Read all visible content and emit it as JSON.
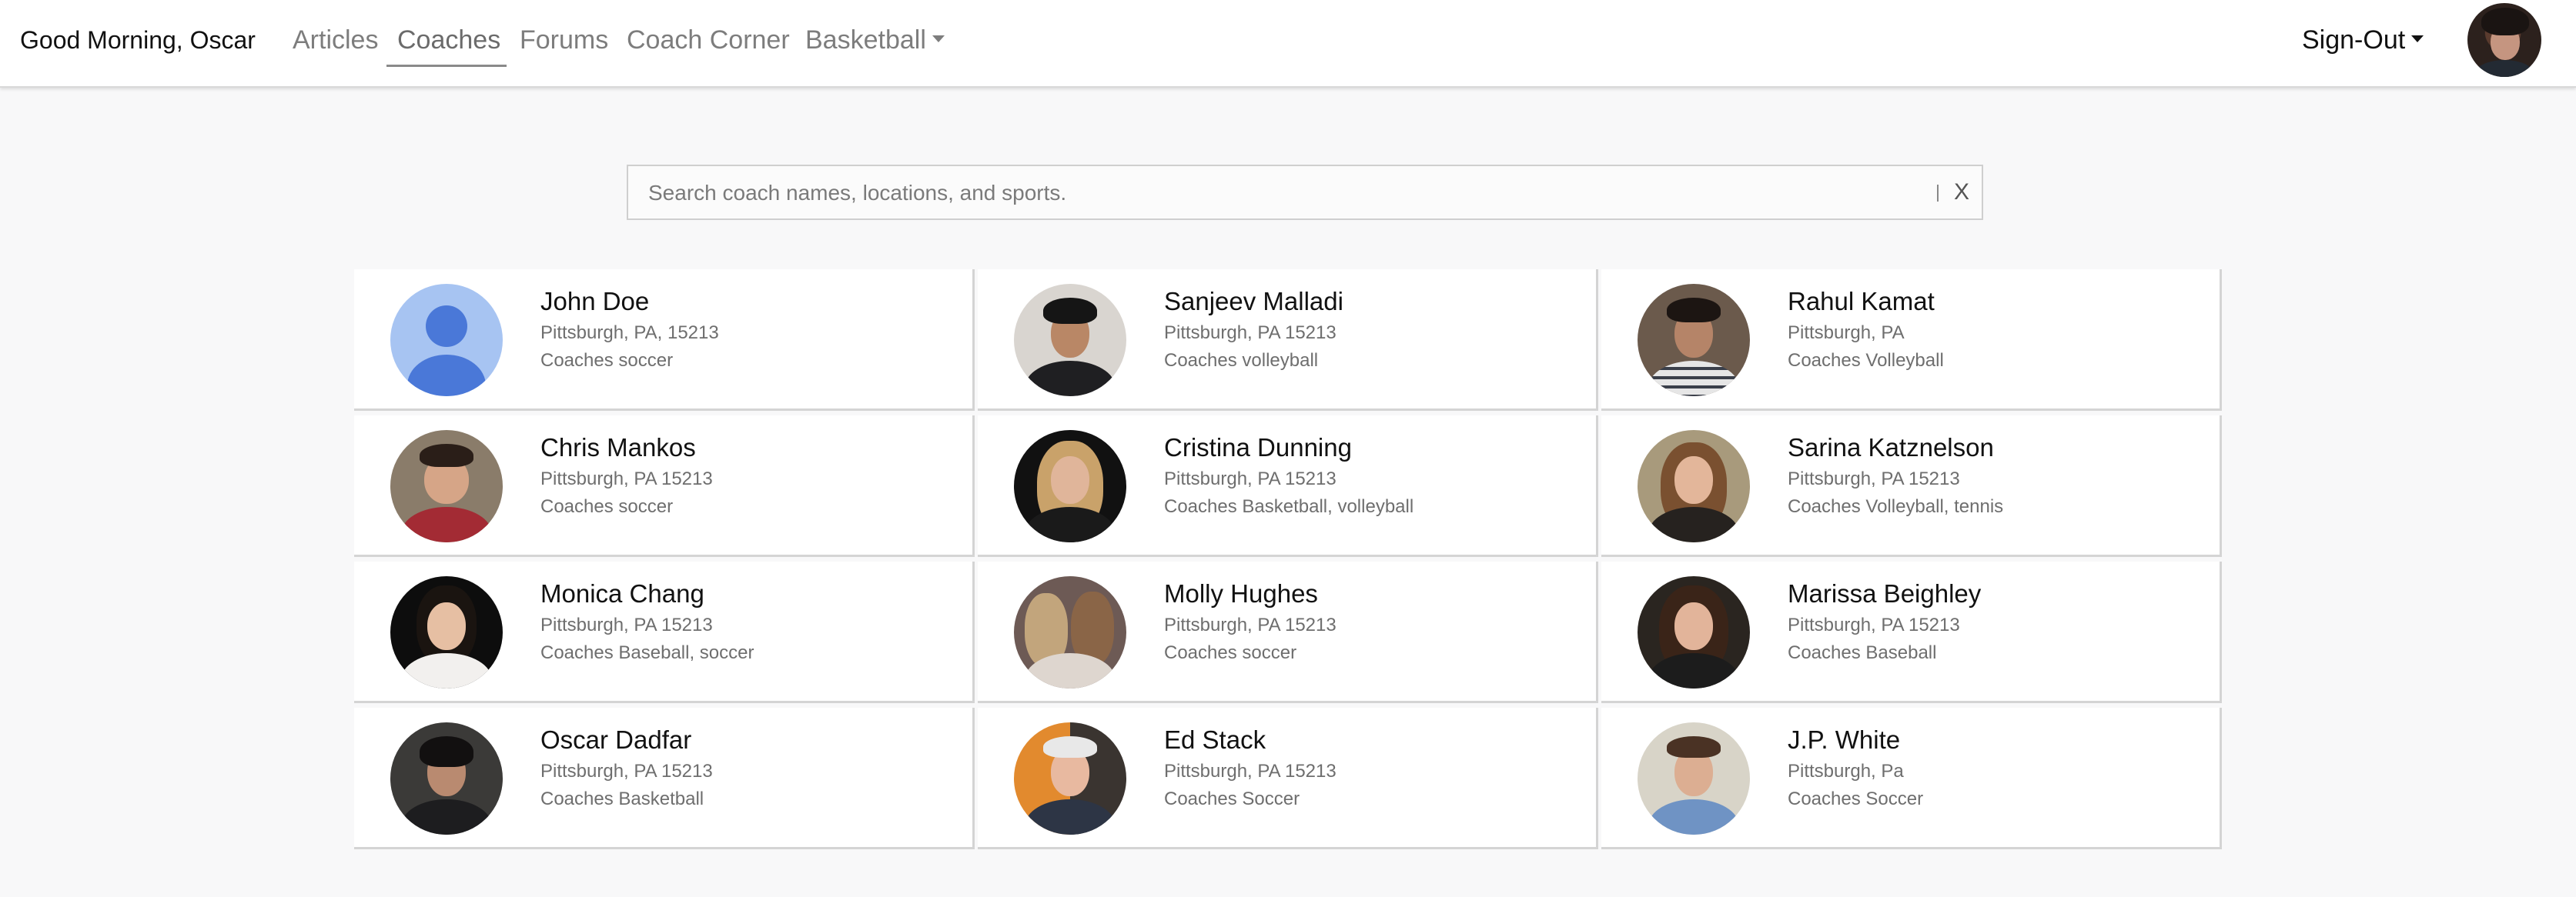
{
  "nav": {
    "greeting": "Good Morning, Oscar",
    "links": [
      "Articles",
      "Coaches",
      "Forums",
      "Coach Corner",
      "Basketball"
    ],
    "active": "Coaches",
    "signout": "Sign-Out"
  },
  "search": {
    "placeholder": "Search coach names, locations, and sports.",
    "value": "",
    "clear_label": "X"
  },
  "coaches": [
    {
      "name": "John Doe",
      "location": "Pittsburgh, PA, 15213",
      "sports": "Coaches soccer"
    },
    {
      "name": "Sanjeev Malladi",
      "location": "Pittsburgh, PA 15213",
      "sports": "Coaches volleyball"
    },
    {
      "name": "Rahul Kamat",
      "location": "Pittsburgh, PA",
      "sports": "Coaches Volleyball"
    },
    {
      "name": "Chris Mankos",
      "location": "Pittsburgh, PA 15213",
      "sports": "Coaches soccer"
    },
    {
      "name": "Cristina Dunning",
      "location": "Pittsburgh, PA 15213",
      "sports": "Coaches Basketball, volleyball"
    },
    {
      "name": "Sarina Katznelson",
      "location": "Pittsburgh, PA 15213",
      "sports": "Coaches Volleyball, tennis"
    },
    {
      "name": "Monica Chang",
      "location": "Pittsburgh, PA 15213",
      "sports": "Coaches Baseball, soccer"
    },
    {
      "name": "Molly Hughes",
      "location": "Pittsburgh, PA 15213",
      "sports": "Coaches soccer"
    },
    {
      "name": "Marissa Beighley",
      "location": "Pittsburgh, PA 15213",
      "sports": "Coaches Baseball"
    },
    {
      "name": "Oscar Dadfar",
      "location": "Pittsburgh, PA 15213",
      "sports": "Coaches Basketball"
    },
    {
      "name": "Ed Stack",
      "location": "Pittsburgh, PA 15213",
      "sports": "Coaches Soccer"
    },
    {
      "name": "J.P. White",
      "location": "Pittsburgh, Pa",
      "sports": "Coaches Soccer"
    }
  ]
}
